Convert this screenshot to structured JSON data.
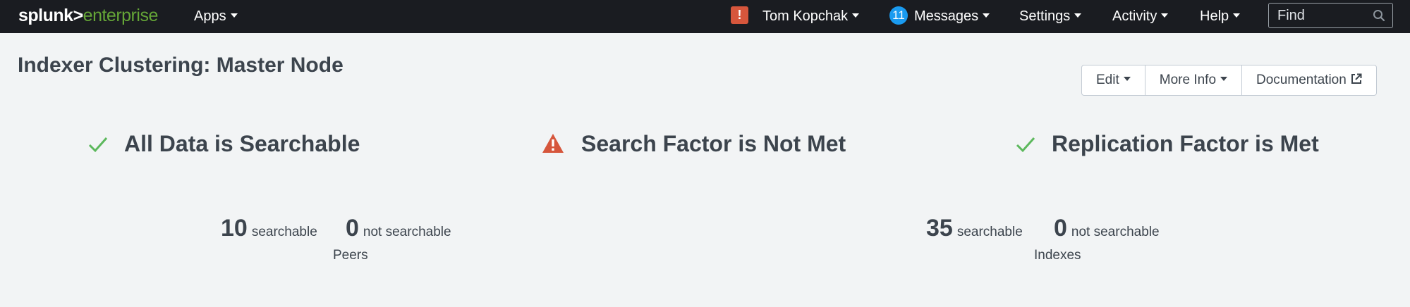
{
  "header": {
    "logo_part1": "splunk>",
    "logo_part2": "enterprise",
    "apps_label": "Apps",
    "alert_badge": "!",
    "user_label": "Tom Kopchak",
    "messages_count": "11",
    "messages_label": "Messages",
    "settings_label": "Settings",
    "activity_label": "Activity",
    "help_label": "Help",
    "find_placeholder": "Find"
  },
  "page": {
    "title": "Indexer Clustering: Master Node",
    "buttons": {
      "edit": "Edit",
      "more_info": "More Info",
      "documentation": "Documentation"
    }
  },
  "status": {
    "data_searchable": "All Data is Searchable",
    "search_factor": "Search Factor is Not Met",
    "replication_factor": "Replication Factor is Met"
  },
  "peers": {
    "searchable_count": "10",
    "searchable_label": "searchable",
    "not_searchable_count": "0",
    "not_searchable_label": "not searchable",
    "caption": "Peers"
  },
  "indexes": {
    "searchable_count": "35",
    "searchable_label": "searchable",
    "not_searchable_count": "0",
    "not_searchable_label": "not searchable",
    "caption": "Indexes"
  },
  "colors": {
    "topbar": "#1a1c21",
    "brand_green": "#65a637",
    "success": "#5cb85c",
    "warning": "#d6563c",
    "message_badge": "#1a9bf0",
    "background": "#f2f4f5"
  }
}
